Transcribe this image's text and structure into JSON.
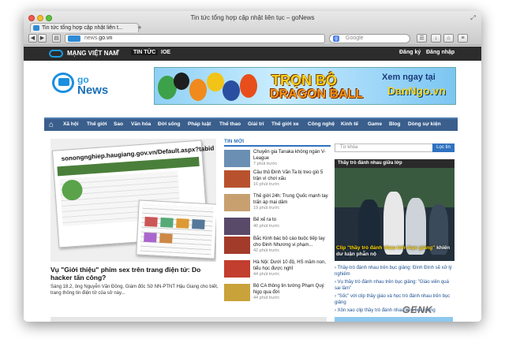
{
  "browser": {
    "window_title": "Tin tức tổng hợp cập nhật liên tục – goNews",
    "tab_title": "Tin tức tổng hợp cập nhật liên t...",
    "url_prefix": "news.",
    "url_domain": "go.vn",
    "search_placeholder": "Google",
    "new_tab_glyph": "+"
  },
  "topnav": {
    "brand": "MẠNG VIỆT NAM",
    "items": [
      "TIN TỨC",
      "IOE"
    ],
    "register": "Đăng ký",
    "login": "Đăng nhập"
  },
  "logo": {
    "go": "go",
    "news": "News"
  },
  "banner": {
    "line1": "TRỌN BỘ",
    "line2": "DRAGON BALL",
    "right1": "Xem ngay tại",
    "right2": "DanNgo.vn"
  },
  "mainnav": {
    "items": [
      "Xã hội",
      "Thế giới",
      "Sao",
      "Văn hóa",
      "Đời sống",
      "Pháp luật",
      "Thể thao",
      "Giải trí",
      "Thế giới xe",
      "Công nghệ",
      "Kinh tế",
      "Game",
      "Blog",
      "Dòng sự kiện"
    ]
  },
  "featured": {
    "screenshot_url_text": "sonongnghiep.haugiang.gov.vn/Default.aspx?tabid",
    "title": "Vụ \"Giới thiệu\" phim sex trên trang điện tử: Do hacker tấn công?",
    "summary": "Sáng 18.2, ông Nguyễn Văn Đồng, Giám đốc Sở NN-PTNT Hậu Giang cho biết, trang thông tin điện tử của sở này..."
  },
  "latest": {
    "heading": "TIN MỚI",
    "items": [
      {
        "title": "Chuyên gia Tanaka không ngán V-League",
        "time": "7 phút trước"
      },
      {
        "title": "Cầu thủ Đinh Văn Ta bị treo giò 5 trận vì chơi xấu",
        "time": "16 phút trước"
      },
      {
        "title": "Thế giới 24h: Trung Quốc mạnh tay trấn áp mại dâm",
        "time": "19 phút trước"
      },
      {
        "title": "Bế xế ra to",
        "time": "40 phút trước"
      },
      {
        "title": "Bắc Kinh bác bỏ cáo buộc tiếp tay cho Đinh Nhương vi phạm...",
        "time": "42 phút trước"
      },
      {
        "title": "Hà Nội: Dưới 10 độ, HS mầm non, tiểu học được nghỉ",
        "time": "44 phút trước"
      },
      {
        "title": "Bộ CA thông tin tướng Phạm Quý Ngọ qua đời",
        "time": "44 phút trước"
      }
    ]
  },
  "sidebar": {
    "search_placeholder": "Từ khóa",
    "search_button": "Lọc tin",
    "video_heading": "Thầy trò đánh nhau giữa lớp",
    "video_caption_prefix": "Clip \"thầy trò đánh nhau trên bục giảng\"",
    "video_caption_suffix": " khiến dư luận phẫn nộ",
    "related": [
      "Thầy-trò đánh nhau trên bục giảng: Đình Đình sẽ xử lý nghiêm",
      "Vụ thầy trò đánh nhau trên bục giảng: \"Giáo viên quá sai lầm\"",
      "\"Sốc\" với clip thầy giáo và học trò đánh nhau trên bục giảng",
      "Xôn xao clip thầy trò đánh nhau trên bục giảng"
    ]
  },
  "watermark": "GENK",
  "colors": {
    "accent": "#2f72c0",
    "nav_bar": "#3a5f8d",
    "top_bar": "#2c2c2c"
  }
}
